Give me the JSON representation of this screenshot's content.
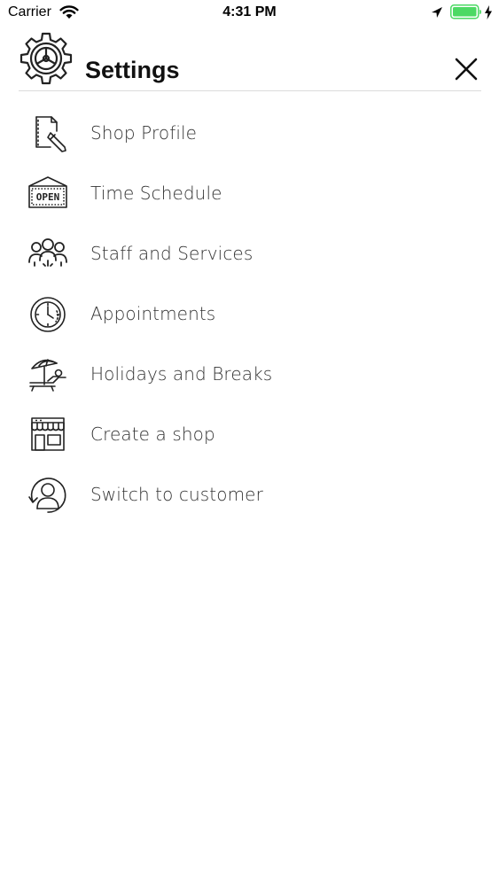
{
  "status_bar": {
    "carrier": "Carrier",
    "time": "4:31 PM",
    "wifi_icon": "wifi-icon",
    "location_icon": "location-arrow-icon",
    "battery_icon": "battery-full-icon",
    "charging_icon": "charging-bolt-icon",
    "battery_color": "#4cd964"
  },
  "header": {
    "title": "Settings",
    "logo_icon": "gear-icon",
    "close_icon": "close-icon"
  },
  "menu": {
    "items": [
      {
        "label": "Shop Profile",
        "icon": "document-edit-icon"
      },
      {
        "label": "Time Schedule",
        "icon": "open-sign-icon"
      },
      {
        "label": "Staff and Services",
        "icon": "staff-group-icon"
      },
      {
        "label": "Appointments",
        "icon": "clock-icon"
      },
      {
        "label": "Holidays and Breaks",
        "icon": "beach-umbrella-icon"
      },
      {
        "label": "Create a shop",
        "icon": "storefront-icon"
      },
      {
        "label": "Switch to customer",
        "icon": "user-switch-icon"
      }
    ],
    "sign_text": "OPEN"
  }
}
